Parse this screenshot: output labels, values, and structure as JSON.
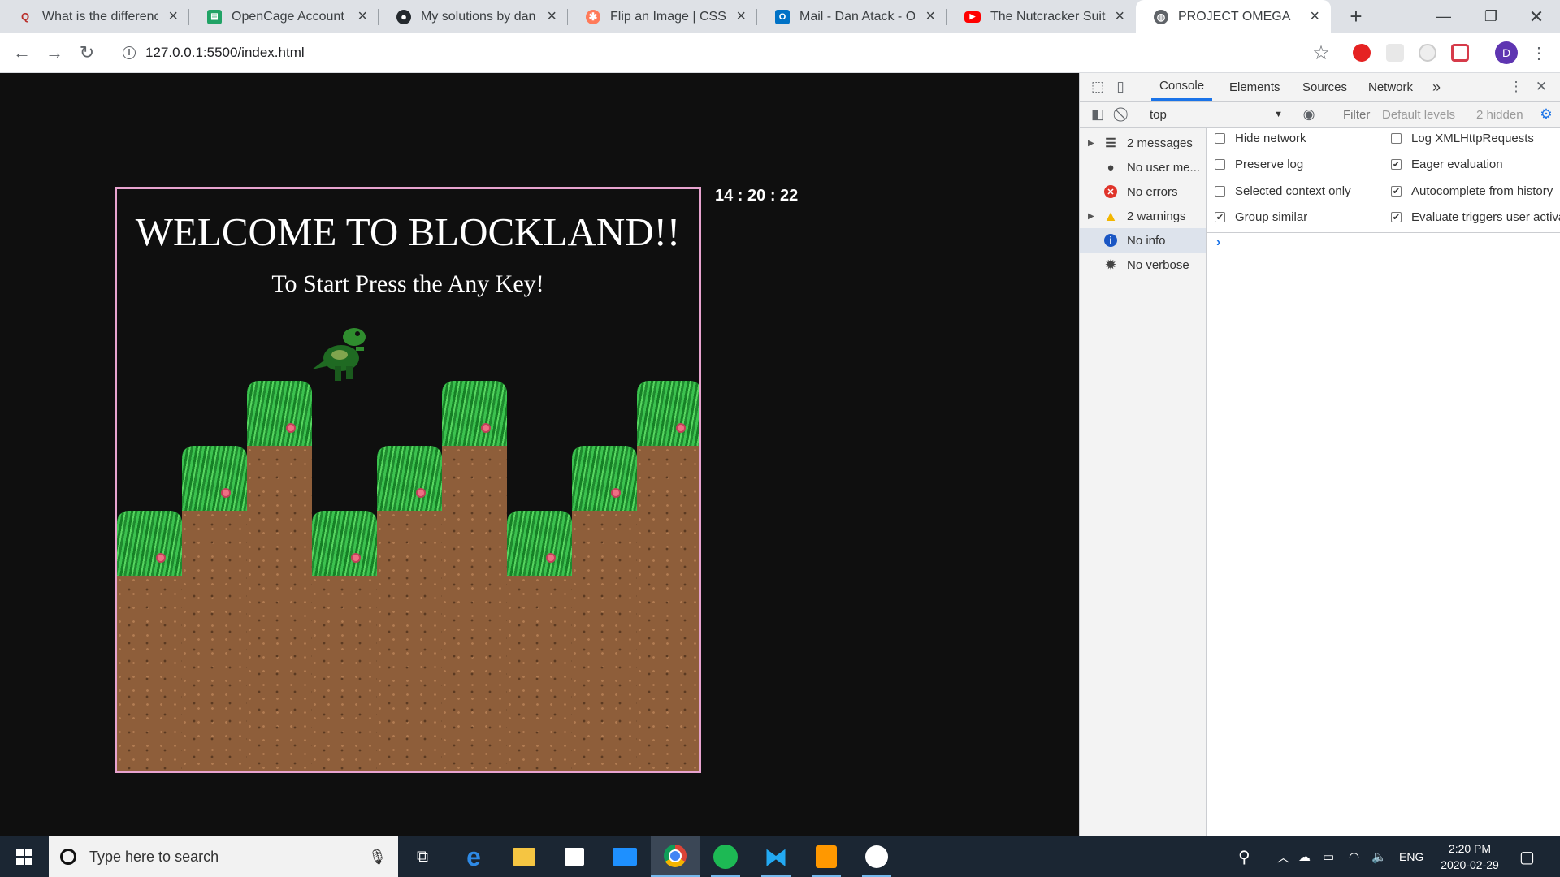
{
  "tabs": [
    {
      "title": "What is the difference b",
      "favicon": "quora-icon"
    },
    {
      "title": "OpenCage Account Da",
      "favicon": "opencage-icon"
    },
    {
      "title": "My solutions by dan-at",
      "favicon": "github-icon"
    },
    {
      "title": "Flip an Image | CSS-Tric",
      "favicon": "css-tricks-icon"
    },
    {
      "title": "Mail - Dan Atack - Outl",
      "favicon": "outlook-icon"
    },
    {
      "title": "The Nutcracker Suite F",
      "favicon": "youtube-icon"
    },
    {
      "title": "PROJECT OMEGA",
      "favicon": "globe-icon",
      "active": true
    }
  ],
  "new_tab_label": "+",
  "omnibox": {
    "url": "127.0.0.1:5500/index.html",
    "info_glyph": "i"
  },
  "profile": {
    "initial": "D",
    "color": "#5e35b1"
  },
  "game": {
    "title": "WELCOME TO BLOCKLAND!!",
    "subtitle": "To Start Press the Any Key!",
    "clock": "14 : 20 : 22",
    "border_color": "#e7a3cf"
  },
  "devtools": {
    "tabs": [
      "Console",
      "Elements",
      "Sources",
      "Network"
    ],
    "active_tab": "Console",
    "more_tabs": "»",
    "context": "top",
    "filter_placeholder": "Filter",
    "levels": "Default levels",
    "hidden_count": "2 hidden",
    "sidebar": [
      {
        "label": "2 messages",
        "icon": "list-icon",
        "expandable": true
      },
      {
        "label": "No user me...",
        "icon": "user-icon",
        "expandable": false
      },
      {
        "label": "No errors",
        "icon": "error-icon",
        "expandable": false
      },
      {
        "label": "2 warnings",
        "icon": "warning-icon",
        "expandable": true
      },
      {
        "label": "No info",
        "icon": "info-icon",
        "expandable": false,
        "selected": true
      },
      {
        "label": "No verbose",
        "icon": "bug-icon",
        "expandable": false
      }
    ],
    "settings_left": [
      {
        "label": "Hide network",
        "checked": false
      },
      {
        "label": "Preserve log",
        "checked": false
      },
      {
        "label": "Selected context only",
        "checked": false
      },
      {
        "label": "Group similar",
        "checked": true
      }
    ],
    "settings_right": [
      {
        "label": "Log XMLHttpRequests",
        "checked": false
      },
      {
        "label": "Eager evaluation",
        "checked": true
      },
      {
        "label": "Autocomplete from history",
        "checked": true
      },
      {
        "label": "Evaluate triggers user activa",
        "checked": true
      }
    ],
    "prompt": "›"
  },
  "taskbar": {
    "search_placeholder": "Type here to search",
    "language": "ENG",
    "time": "2:20 PM",
    "date": "2020-02-29"
  }
}
